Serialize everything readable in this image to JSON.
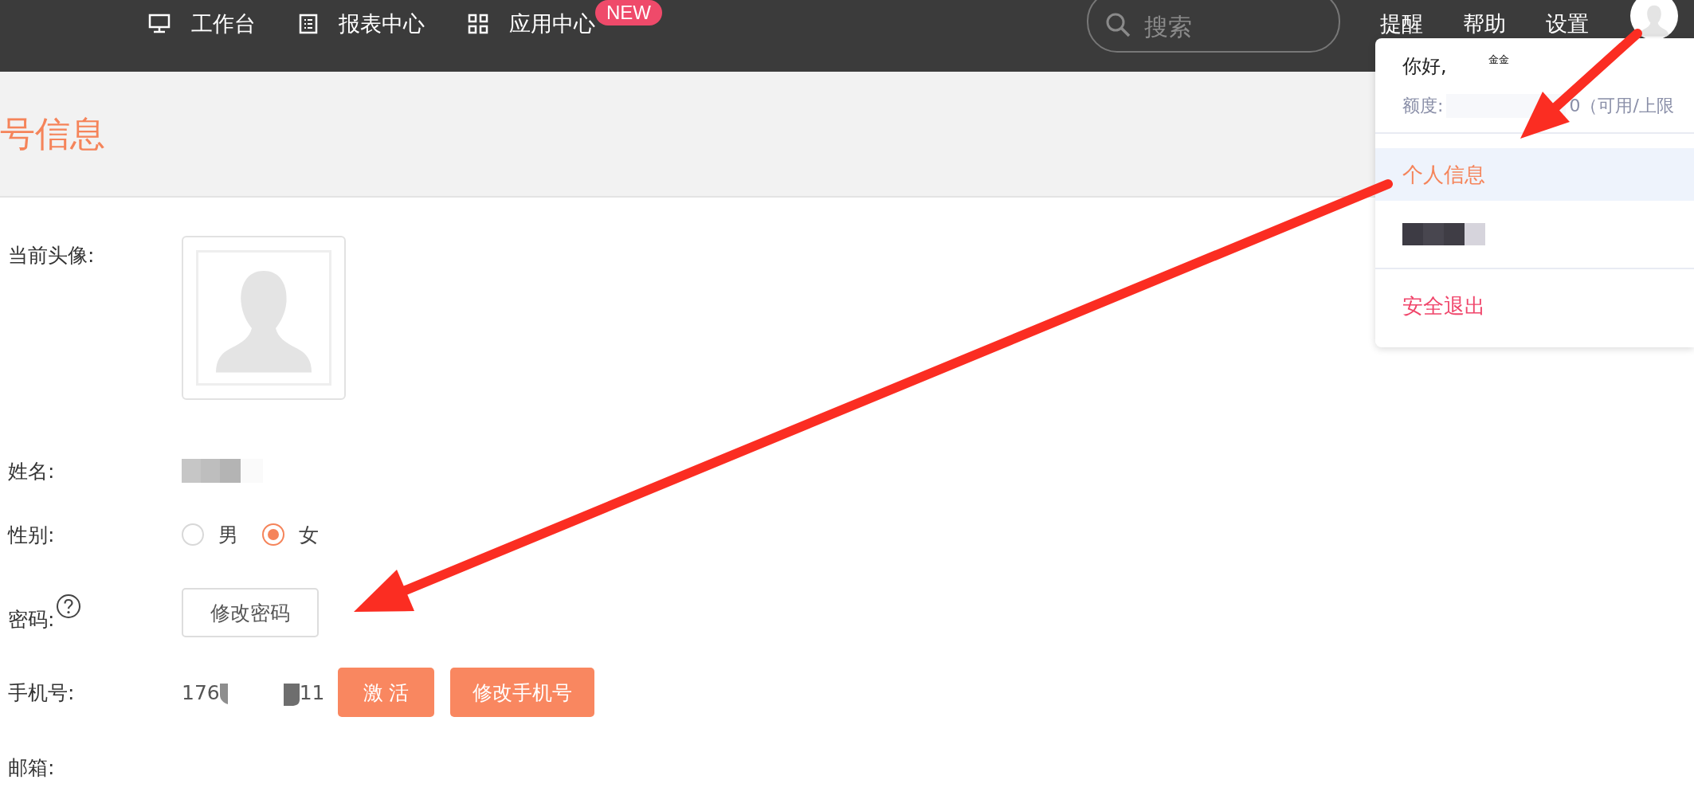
{
  "top_nav": {
    "items": [
      {
        "kind": "monitor",
        "label": "工作台"
      },
      {
        "kind": "list",
        "label": "报表中心"
      },
      {
        "kind": "grid",
        "label": "应用中心",
        "badge": "NEW"
      }
    ],
    "search": {
      "placeholder": "搜索"
    },
    "links": [
      "提醒",
      "帮助",
      "设置"
    ]
  },
  "page_title": "号信息",
  "form": {
    "rows": [
      {
        "kind": "avatar",
        "label": "当前头像:"
      },
      {
        "kind": "redacted",
        "label": "姓名:"
      },
      {
        "kind": "radio",
        "label": "性别:",
        "options": [
          {
            "label": "男",
            "selected": false
          },
          {
            "label": "女",
            "selected": true
          }
        ]
      },
      {
        "kind": "button",
        "label": "密码:",
        "help": true,
        "button": "修改密码"
      },
      {
        "kind": "phone",
        "label": "手机号:",
        "value_start": "176",
        "value_end": "11",
        "buttons": [
          "激 活",
          "修改手机号"
        ]
      },
      {
        "kind": "empty",
        "label": "邮箱:"
      }
    ]
  },
  "user_menu": {
    "greeting": "你好,",
    "name_fragment": "金金",
    "quota_label": "额度:",
    "quota_tail": "0（可用/上限",
    "items": [
      {
        "kind": "link",
        "label": "个人信息",
        "selected": true
      },
      {
        "kind": "redacted",
        "selected": false
      },
      {
        "kind": "danger",
        "label": "安全退出",
        "selected": false
      }
    ]
  }
}
